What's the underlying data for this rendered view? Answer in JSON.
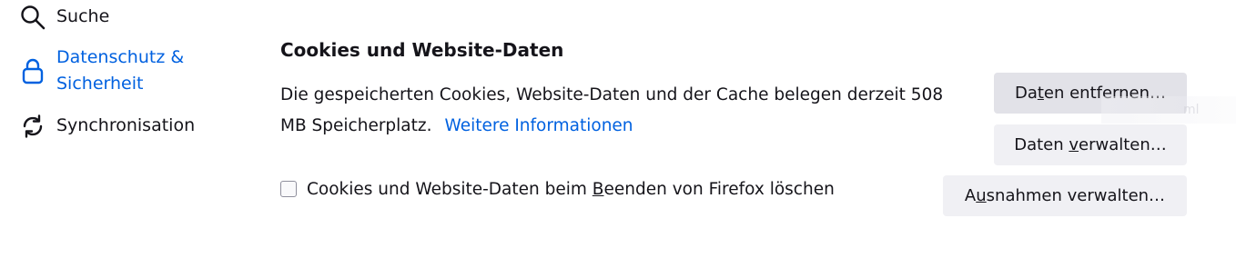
{
  "sidebar": {
    "items": [
      {
        "label": "Suche",
        "icon": "search-icon",
        "active": false
      },
      {
        "label": "Datenschutz & Sicherheit",
        "icon": "lock-icon",
        "active": true
      },
      {
        "label": "Synchronisation",
        "icon": "sync-icon",
        "active": false
      }
    ]
  },
  "cookies": {
    "title": "Cookies und Website-Daten",
    "description": "Die gespeicherten Cookies, Website-Daten und der Cache belegen derzeit 508 MB Speicherplatz.",
    "learn_more": "Weitere Informationen",
    "storage_used": "508 MB",
    "buttons": {
      "clear_pre": "Da",
      "clear_key": "t",
      "clear_post": "en entfernen…",
      "manage_pre": "Daten ",
      "manage_key": "v",
      "manage_post": "erwalten…",
      "exceptions_pre": "A",
      "exceptions_key": "u",
      "exceptions_post": "snahmen verwalten…"
    },
    "checkbox": {
      "label_pre": "Cookies und Website-Daten beim ",
      "label_key": "B",
      "label_post": "eenden von Firefox löschen",
      "checked": false
    }
  },
  "colors": {
    "accent": "#0061e0",
    "text": "#15141a",
    "button_bg": "#f0f0f4",
    "button_hover_bg": "#e2e2e8"
  },
  "ghost_overlay": {
    "text": "ml"
  }
}
